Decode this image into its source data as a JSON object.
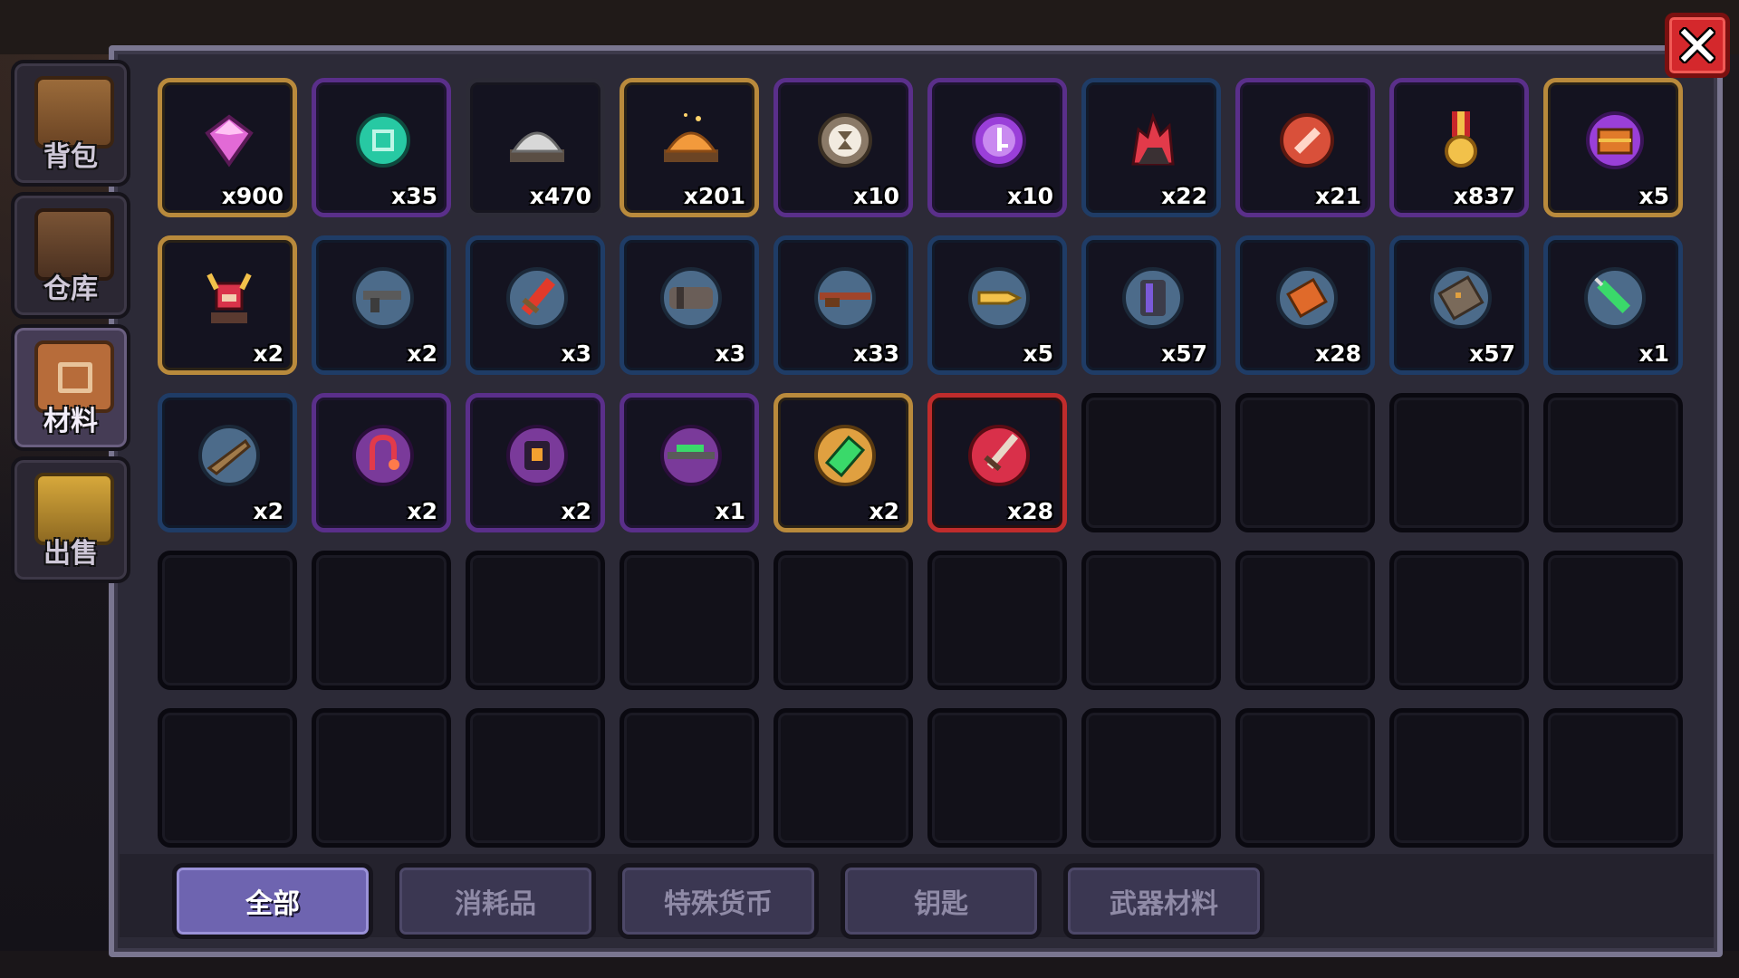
{
  "side_tabs": [
    {
      "label": "背包",
      "icon": "chest-icon",
      "active": false
    },
    {
      "label": "仓库",
      "icon": "warehouse-chest-icon",
      "active": false
    },
    {
      "label": "材料",
      "icon": "materials-icon",
      "active": true
    },
    {
      "label": "出售",
      "icon": "gold-coins-icon",
      "active": false
    }
  ],
  "items": [
    {
      "icon": "pink-gem-icon",
      "count": "x900",
      "rarity": "gold"
    },
    {
      "icon": "teal-token-icon",
      "count": "x35",
      "rarity": "purple"
    },
    {
      "icon": "silver-ore-pile-icon",
      "count": "x470",
      "rarity": "dark"
    },
    {
      "icon": "orange-dust-pile-icon",
      "count": "x201",
      "rarity": "gold"
    },
    {
      "icon": "hourglass-coin-icon",
      "count": "x10",
      "rarity": "purple"
    },
    {
      "icon": "purple-key-coin-icon",
      "count": "x10",
      "rarity": "purple"
    },
    {
      "icon": "red-crystal-icon",
      "count": "x22",
      "rarity": "blue"
    },
    {
      "icon": "red-ticket-coin-icon",
      "count": "x21",
      "rarity": "purple"
    },
    {
      "icon": "gold-medal-icon",
      "count": "x837",
      "rarity": "purple"
    },
    {
      "icon": "treasure-chest-coin-icon",
      "count": "x5",
      "rarity": "gold"
    },
    {
      "icon": "horned-helmet-figure-icon",
      "count": "x2",
      "rarity": "gold"
    },
    {
      "icon": "gun-part-icon",
      "count": "x2",
      "rarity": "blue"
    },
    {
      "icon": "red-blade-part-icon",
      "count": "x3",
      "rarity": "blue"
    },
    {
      "icon": "barrel-part-icon",
      "count": "x3",
      "rarity": "blue"
    },
    {
      "icon": "rifle-part-icon",
      "count": "x33",
      "rarity": "blue"
    },
    {
      "icon": "golden-bullet-icon",
      "count": "x5",
      "rarity": "blue"
    },
    {
      "icon": "magazine-part-icon",
      "count": "x57",
      "rarity": "blue"
    },
    {
      "icon": "orange-block-icon",
      "count": "x28",
      "rarity": "blue"
    },
    {
      "icon": "circuit-plate-icon",
      "count": "x57",
      "rarity": "blue"
    },
    {
      "icon": "green-syringe-icon",
      "count": "x1",
      "rarity": "blue"
    },
    {
      "icon": "wooden-stock-icon",
      "count": "x2",
      "rarity": "blue"
    },
    {
      "icon": "red-hook-icon",
      "count": "x2",
      "rarity": "purple"
    },
    {
      "icon": "orange-core-icon",
      "count": "x2",
      "rarity": "purple"
    },
    {
      "icon": "green-rifle-part-icon",
      "count": "x1",
      "rarity": "purple"
    },
    {
      "icon": "green-scroll-icon",
      "count": "x2",
      "rarity": "gold"
    },
    {
      "icon": "red-dagger-icon",
      "count": "x28",
      "rarity": "red"
    }
  ],
  "total_slots": 50,
  "filter_tabs": [
    {
      "label": "全部",
      "active": true
    },
    {
      "label": "消耗品",
      "active": false
    },
    {
      "label": "特殊货币",
      "active": false
    },
    {
      "label": "钥匙",
      "active": false
    },
    {
      "label": "武器材料",
      "active": false
    }
  ],
  "close_icon": "close-x-icon",
  "colors": {
    "rarity_gold": "#b98a3c",
    "rarity_purple": "#5a2f8a",
    "rarity_blue": "#1f3c66",
    "rarity_red": "#c02c2c",
    "close_button": "#d4282c",
    "active_tab": "#6e64b0"
  }
}
